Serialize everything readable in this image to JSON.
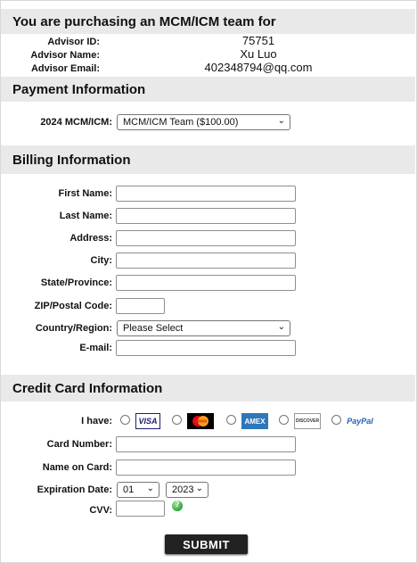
{
  "header": {
    "title": "You are purchasing an MCM/ICM team for"
  },
  "advisor": {
    "id_label": "Advisor ID:",
    "id_value": "75751",
    "name_label": "Advisor Name:",
    "name_value": "Xu Luo",
    "email_label": "Advisor Email:",
    "email_value": "402348794@qq.com"
  },
  "payment": {
    "title": "Payment Information",
    "team_label": "2024 MCM/ICM:",
    "team_selected": "MCM/ICM Team ($100.00)"
  },
  "billing": {
    "title": "Billing Information",
    "first_name_label": "First Name:",
    "last_name_label": "Last Name:",
    "address_label": "Address:",
    "city_label": "City:",
    "state_label": "State/Province:",
    "zip_label": "ZIP/Postal Code:",
    "country_label": "Country/Region:",
    "country_selected": "Please Select",
    "email_label": "E-mail:"
  },
  "credit": {
    "title": "Credit Card Information",
    "have_label": "I have:",
    "cards": {
      "visa": "VISA",
      "mastercard": "MasterCard",
      "amex": "AMEX",
      "discover": "DISCOVER",
      "paypal": "PayPal"
    },
    "card_number_label": "Card Number:",
    "name_on_card_label": "Name on Card:",
    "expiration_label": "Expiration Date:",
    "exp_month": "01",
    "exp_year": "2023",
    "cvv_label": "CVV:"
  },
  "submit_label": "SUBMIT",
  "colors": {
    "section_bg": "#e9e9e9",
    "submit_bg": "#222222",
    "cvv_help": "#3cb043"
  }
}
